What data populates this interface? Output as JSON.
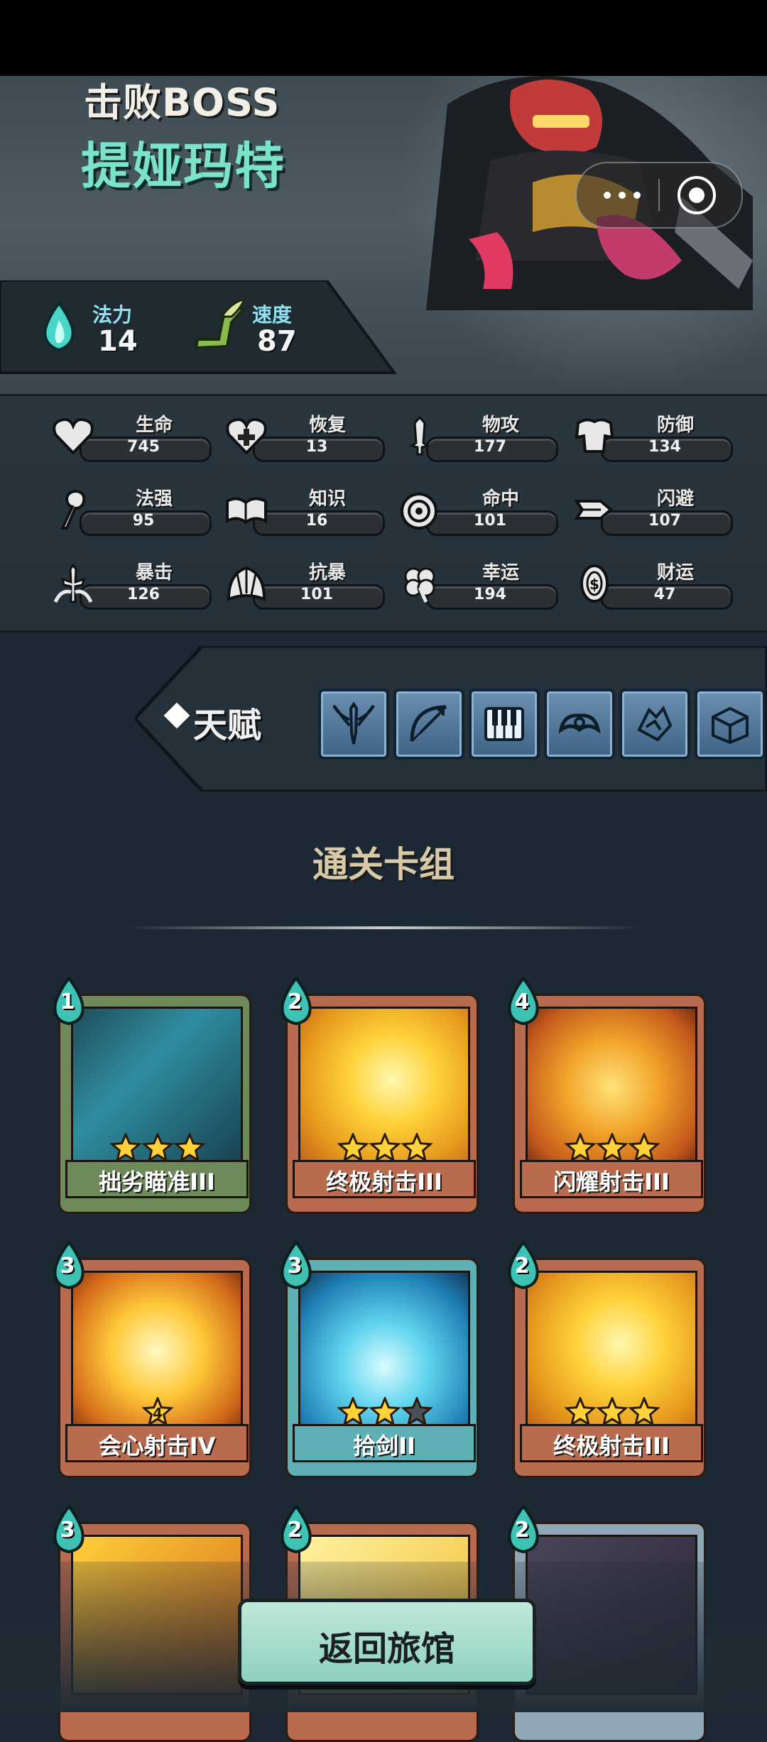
{
  "header": {
    "boss_label": "击败BOSS",
    "boss_name": "提娅玛特"
  },
  "capsule": {
    "more_icon": "more-dots-icon",
    "close_icon": "mini-close-icon"
  },
  "core_stats": [
    {
      "label": "法力",
      "value": "14",
      "icon": "mana-flame-icon"
    },
    {
      "label": "速度",
      "value": "87",
      "icon": "winged-boot-icon"
    }
  ],
  "attributes": [
    {
      "label": "生命",
      "value": "745",
      "icon": "heart-icon"
    },
    {
      "label": "恢复",
      "value": "13",
      "icon": "heart-plus-icon"
    },
    {
      "label": "物攻",
      "value": "177",
      "icon": "sword-icon"
    },
    {
      "label": "防御",
      "value": "134",
      "icon": "armor-icon"
    },
    {
      "label": "法强",
      "value": "95",
      "icon": "staff-icon"
    },
    {
      "label": "知识",
      "value": "16",
      "icon": "book-icon"
    },
    {
      "label": "命中",
      "value": "101",
      "icon": "target-icon"
    },
    {
      "label": "闪避",
      "value": "107",
      "icon": "dash-icon"
    },
    {
      "label": "暴击",
      "value": "126",
      "icon": "crit-sword-icon"
    },
    {
      "label": "抗暴",
      "value": "101",
      "icon": "shell-icon"
    },
    {
      "label": "幸运",
      "value": "194",
      "icon": "clover-icon"
    },
    {
      "label": "财运",
      "value": "47",
      "icon": "coin-icon"
    }
  ],
  "talent": {
    "label": "天赋",
    "slots": [
      "winged-sword-icon",
      "bow-icon",
      "piano-icon",
      "muscle-icon",
      "hand-icon",
      "chest-icon"
    ]
  },
  "deck": {
    "title": "通关卡组",
    "cards": [
      {
        "name": "拙劣瞄准III",
        "cost": "1",
        "stars": 3,
        "star_level": "",
        "rarity_color": "#6e8a5a",
        "art": "dark-gun"
      },
      {
        "name": "终极射击III",
        "cost": "2",
        "stars": 3,
        "star_level": "",
        "rarity_color": "#b86b4f",
        "art": "yellow-burst"
      },
      {
        "name": "闪耀射击III",
        "cost": "4",
        "stars": 3,
        "star_level": "",
        "rarity_color": "#b86b4f",
        "art": "rock-burst"
      },
      {
        "name": "会心射击IV",
        "cost": "3",
        "stars": 1,
        "star_level": "4",
        "rarity_color": "#b86b4f",
        "art": "crit-burst"
      },
      {
        "name": "拾剑II",
        "cost": "3",
        "stars": 2,
        "star_level": "",
        "rarity_color": "#5fb0b5",
        "art": "sword-rays"
      },
      {
        "name": "终极射击III",
        "cost": "2",
        "stars": 3,
        "star_level": "",
        "rarity_color": "#b86b4f",
        "art": "yellow-burst"
      },
      {
        "name": "",
        "cost": "3",
        "stars": 0,
        "star_level": "",
        "rarity_color": "#b86b4f",
        "art": "orange-partial"
      },
      {
        "name": "",
        "cost": "2",
        "stars": 0,
        "star_level": "",
        "rarity_color": "#b86b4f",
        "art": "yellow-partial"
      },
      {
        "name": "",
        "cost": "2",
        "stars": 0,
        "star_level": "",
        "rarity_color": "#8fa7b7",
        "art": "purple-partial"
      }
    ]
  },
  "footer": {
    "return_label": "返回旅馆"
  }
}
